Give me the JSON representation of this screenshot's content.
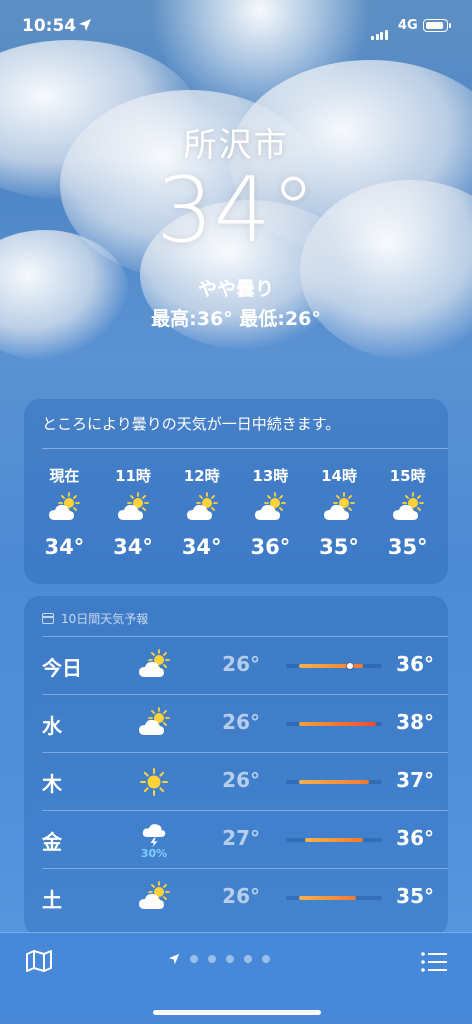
{
  "status": {
    "time": "10:54",
    "network": "4G"
  },
  "hero": {
    "city": "所沢市",
    "temperature": "34°",
    "condition": "やや曇り",
    "high_low": "最高:36°  最低:26°"
  },
  "hourly": {
    "summary": "ところにより曇りの天気が一日中続きます。",
    "items": [
      {
        "label": "現在",
        "icon": "partly-cloudy-icon",
        "temp": "34°"
      },
      {
        "label": "11時",
        "icon": "partly-cloudy-icon",
        "temp": "34°"
      },
      {
        "label": "12時",
        "icon": "partly-cloudy-icon",
        "temp": "34°"
      },
      {
        "label": "13時",
        "icon": "partly-cloudy-icon",
        "temp": "36°"
      },
      {
        "label": "14時",
        "icon": "partly-cloudy-icon",
        "temp": "35°"
      },
      {
        "label": "15時",
        "icon": "partly-cloudy-icon",
        "temp": "35°"
      }
    ]
  },
  "daily": {
    "header": "10日間天気予報",
    "range_min": 24,
    "range_max": 39,
    "current_temp": 34,
    "items": [
      {
        "day": "今日",
        "icon": "partly-cloudy-icon",
        "pop": "",
        "low": "26°",
        "high": "36°",
        "low_v": 26,
        "high_v": 36,
        "current": true
      },
      {
        "day": "水",
        "icon": "partly-cloudy-icon",
        "pop": "",
        "low": "26°",
        "high": "38°",
        "low_v": 26,
        "high_v": 38,
        "current": false
      },
      {
        "day": "木",
        "icon": "sun-icon",
        "pop": "",
        "low": "26°",
        "high": "37°",
        "low_v": 26,
        "high_v": 37,
        "current": false
      },
      {
        "day": "金",
        "icon": "thunderstorm-icon",
        "pop": "30%",
        "low": "27°",
        "high": "36°",
        "low_v": 27,
        "high_v": 36,
        "current": false
      },
      {
        "day": "土",
        "icon": "partly-cloudy-icon",
        "pop": "",
        "low": "26°",
        "high": "35°",
        "low_v": 26,
        "high_v": 35,
        "current": false
      }
    ]
  },
  "toolbar": {
    "page_count": 6,
    "active_page": 0
  }
}
